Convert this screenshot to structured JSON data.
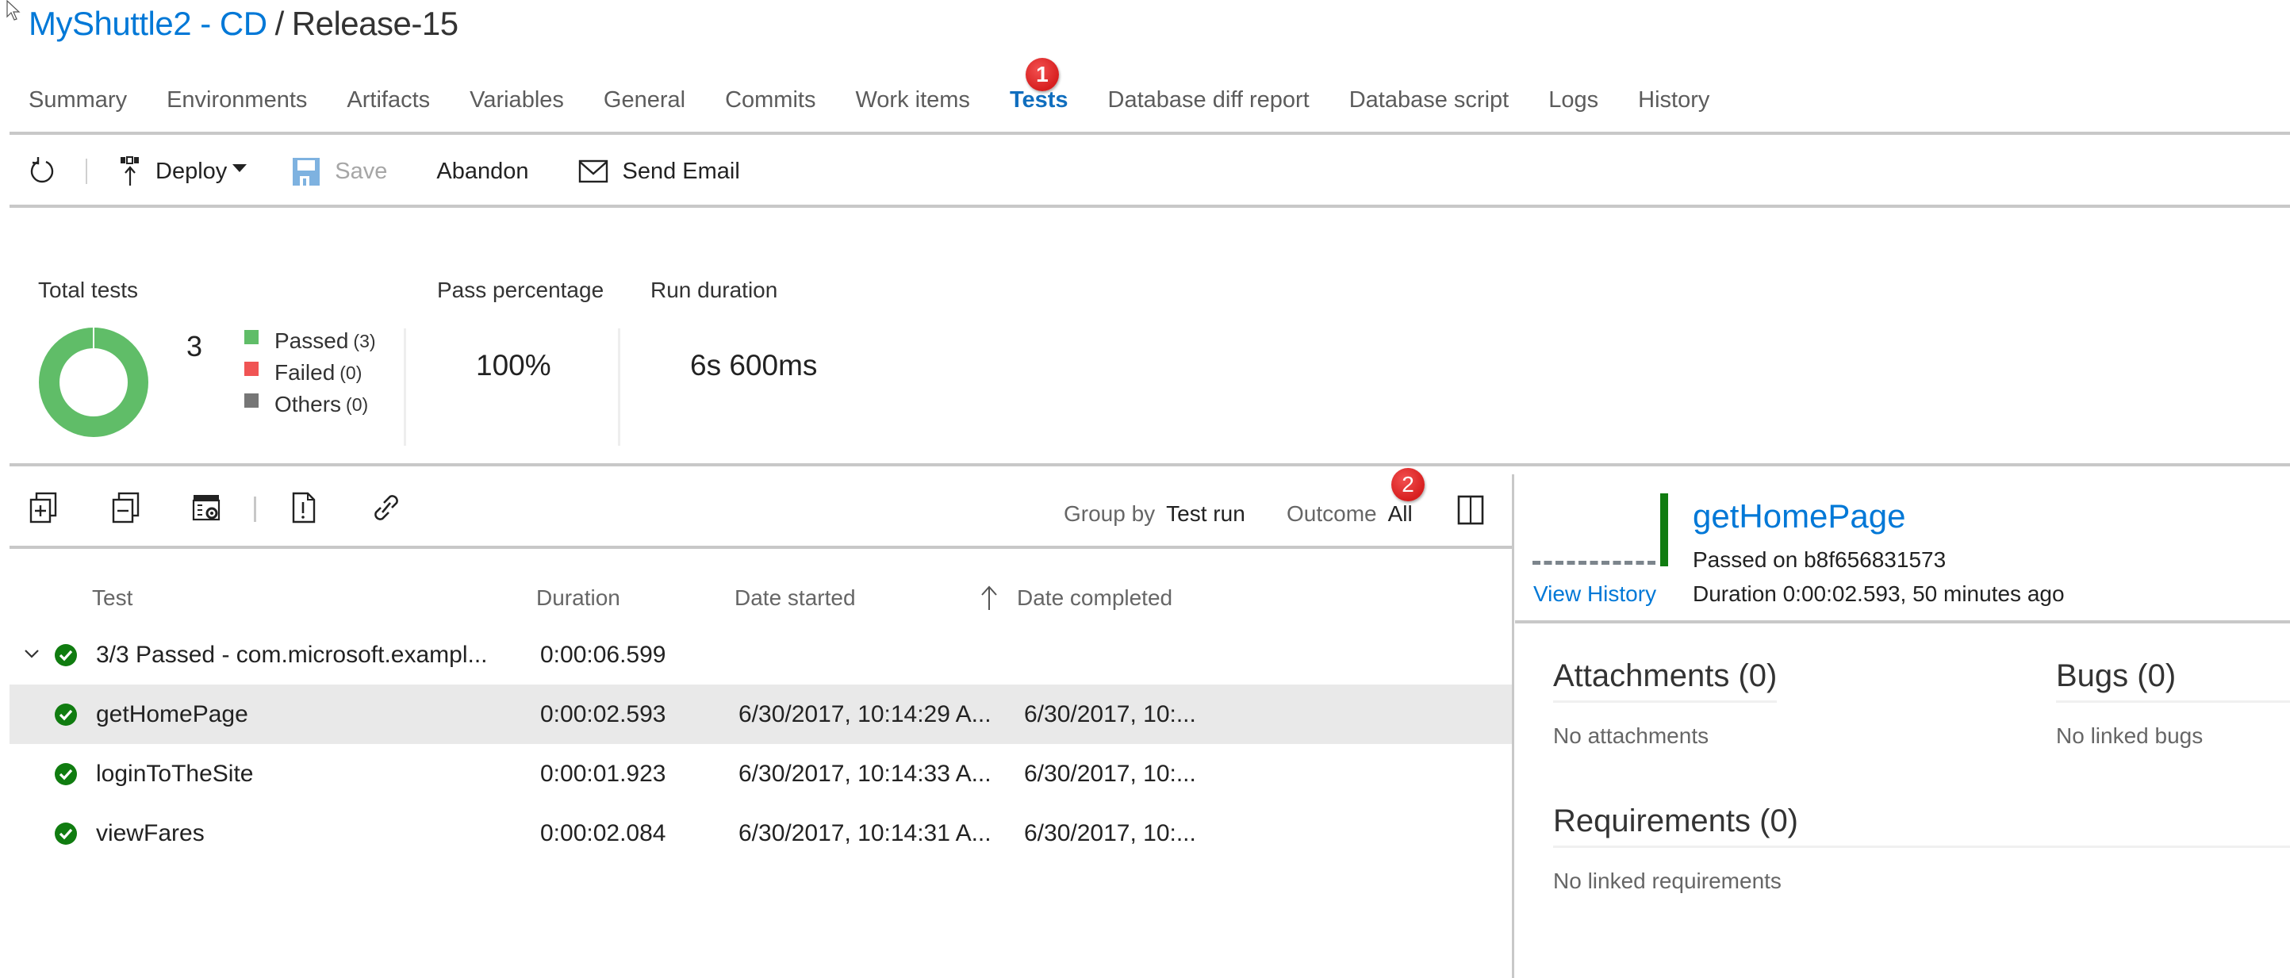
{
  "header": {
    "pipeline_link": "MyShuttle2 - CD",
    "separator": "/",
    "release": "Release-15"
  },
  "tabs": [
    {
      "label": "Summary",
      "active": false
    },
    {
      "label": "Environments",
      "active": false
    },
    {
      "label": "Artifacts",
      "active": false
    },
    {
      "label": "Variables",
      "active": false
    },
    {
      "label": "General",
      "active": false
    },
    {
      "label": "Commits",
      "active": false
    },
    {
      "label": "Work items",
      "active": false
    },
    {
      "label": "Tests",
      "active": true,
      "badge": "1"
    },
    {
      "label": "Database diff report",
      "active": false
    },
    {
      "label": "Database script",
      "active": false
    },
    {
      "label": "Logs",
      "active": false
    },
    {
      "label": "History",
      "active": false
    }
  ],
  "toolbar": {
    "refresh_icon": "refresh-icon",
    "deploy_label": "Deploy",
    "save_label": "Save",
    "abandon_label": "Abandon",
    "send_email_label": "Send Email"
  },
  "summary": {
    "total_tests_label": "Total tests",
    "total_tests": "3",
    "legend": [
      {
        "label": "Passed",
        "count": "(3)",
        "color": "#60bd68"
      },
      {
        "label": "Failed",
        "count": "(0)",
        "color": "#f05454"
      },
      {
        "label": "Others",
        "count": "(0)",
        "color": "#767676"
      }
    ],
    "donut_passed_fraction": 1.0,
    "pass_percentage_label": "Pass percentage",
    "pass_percentage": "100%",
    "run_duration_label": "Run duration",
    "run_duration": "6s 600ms"
  },
  "list_toolbar": {
    "icons": [
      "expand-all-icon",
      "collapse-all-icon",
      "column-options-icon",
      "create-bug-icon",
      "link-icon"
    ],
    "group_by_label": "Group by",
    "group_by_value": "Test run",
    "outcome_label": "Outcome",
    "outcome_value": "All",
    "outcome_badge": "2"
  },
  "table": {
    "columns": {
      "test": "Test",
      "duration": "Duration",
      "date_started": "Date started",
      "date_completed": "Date completed"
    },
    "group": {
      "label": "3/3 Passed - com.microsoft.exampl...",
      "duration": "0:00:06.599"
    },
    "rows": [
      {
        "name": "getHomePage",
        "duration": "0:00:02.593",
        "started": "6/30/2017, 10:14:29 A...",
        "completed": "6/30/2017, 10:...",
        "selected": true
      },
      {
        "name": "loginToTheSite",
        "duration": "0:00:01.923",
        "started": "6/30/2017, 10:14:33 A...",
        "completed": "6/30/2017, 10:...",
        "selected": false
      },
      {
        "name": "viewFares",
        "duration": "0:00:02.084",
        "started": "6/30/2017, 10:14:31 A...",
        "completed": "6/30/2017, 10:...",
        "selected": false
      }
    ]
  },
  "details": {
    "test_name": "getHomePage",
    "passed_on": "Passed on b8f656831573",
    "view_history": "View History",
    "duration": "Duration 0:00:02.593, 50 minutes ago",
    "attachments_heading": "Attachments (0)",
    "attachments_empty": "No attachments",
    "bugs_heading": "Bugs (0)",
    "bugs_empty": "No linked bugs",
    "requirements_heading": "Requirements (0)",
    "requirements_empty": "No linked requirements"
  },
  "colors": {
    "accent": "#0078d7",
    "active_tab": "#106ebe",
    "passed": "#107c10",
    "donut": "#60bd68",
    "badge": "#e02b2b"
  }
}
